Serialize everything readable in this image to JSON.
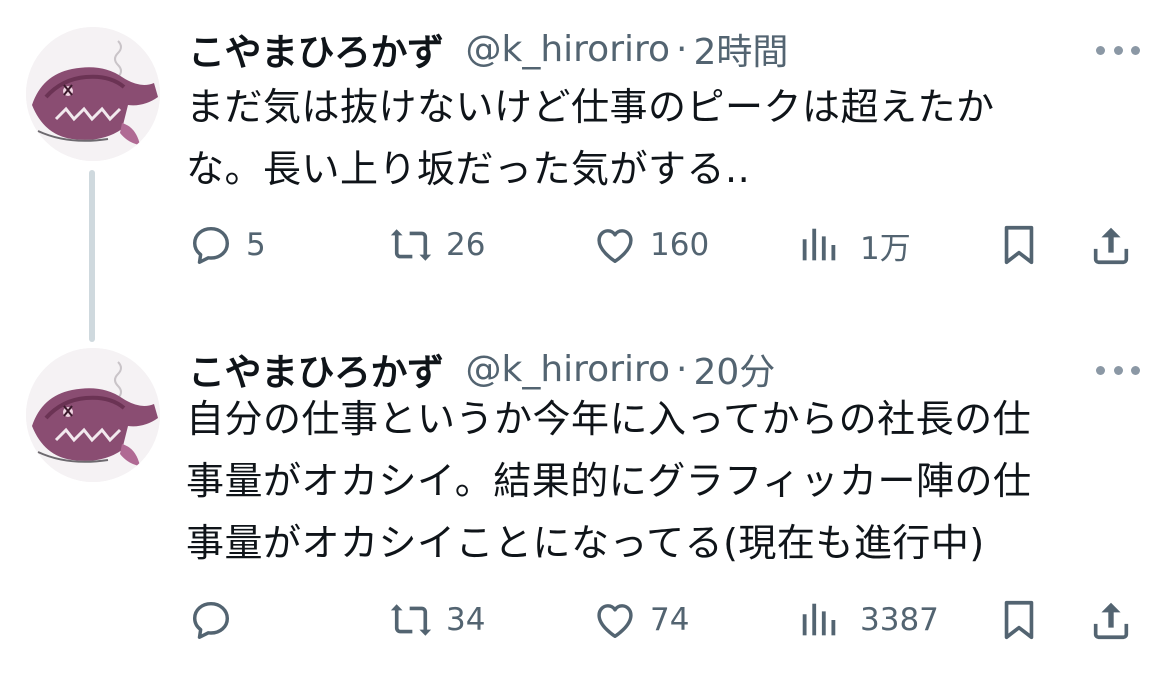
{
  "colors": {
    "text_primary": "#0f1419",
    "text_secondary": "#536471",
    "thread_line": "#cfd9de",
    "icon": "#536471"
  },
  "tweets": [
    {
      "name": "こやまひろかず",
      "handle": "@k_hiroriro",
      "separator": "·",
      "time": "2時間",
      "text": "まだ気は抜けないけど仕事のピークは超えたか\nな。長い上り坂だった気がする..",
      "replies": "5",
      "retweets": "26",
      "likes": "160",
      "views": "1万",
      "icons": {
        "reply": "reply-icon",
        "retweet": "retweet-icon",
        "like": "heart-icon",
        "views": "views-chart-icon",
        "bookmark": "bookmark-icon",
        "share": "share-icon",
        "more": "more-dots-icon"
      }
    },
    {
      "name": "こやまひろかず",
      "handle": "@k_hiroriro",
      "separator": "·",
      "time": "20分",
      "text": "自分の仕事というか今年に入ってからの社長の仕\n事量がオカシイ。結果的にグラフィッカー陣の仕\n事量がオカシイことになってる(現在も進行中)",
      "replies": "",
      "retweets": "34",
      "likes": "74",
      "views": "3387",
      "icons": {
        "reply": "reply-icon",
        "retweet": "retweet-icon",
        "like": "heart-icon",
        "views": "views-chart-icon",
        "bookmark": "bookmark-icon",
        "share": "share-icon",
        "more": "more-dots-icon"
      }
    }
  ]
}
